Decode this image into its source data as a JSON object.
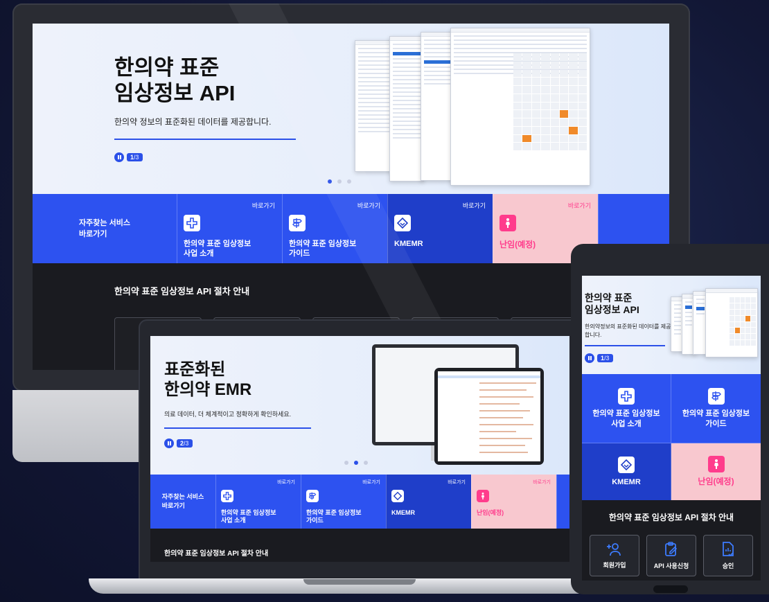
{
  "colors": {
    "accent": "#2d52f0",
    "accent_dark": "#1f3ec9",
    "pink_bg": "#f8c8cf",
    "pink_text": "#ff3c8c",
    "dark_band": "#1a1b20"
  },
  "monitor": {
    "hero": {
      "title_line1": "한의약 표준",
      "title_line2": "임상정보 API",
      "subtitle": "한의약 정보의 표준화된 데이터를 제공합니다.",
      "slide_current": "1",
      "slide_total": "/3"
    },
    "services": {
      "label_line1": "자주찾는 서비스",
      "label_line2": "바로가기",
      "go_label": "바로가기",
      "cards": [
        {
          "title_line1": "한의약 표준 임상정보",
          "title_line2": "사업 소개",
          "icon": "medical-cross-icon"
        },
        {
          "title_line1": "한의약 표준 임상정보",
          "title_line2": "가이드",
          "icon": "signpost-icon"
        },
        {
          "title_line1": "KMEMR",
          "title_line2": "",
          "icon": "kmemr-logo-icon"
        },
        {
          "title_line1": "난임(예정)",
          "title_line2": "",
          "icon": "pregnant-woman-icon"
        }
      ]
    },
    "procedure_title": "한의약 표준 임상정보 API 절차 안내"
  },
  "laptop": {
    "hero": {
      "title_line1": "표준화된",
      "title_line2": "한의약 EMR",
      "subtitle": "의료 데이터, 더 체계적이고 정확하게 확인하세요.",
      "slide_current": "2",
      "slide_total": "/3"
    },
    "services": {
      "label_line1": "자주찾는 서비스",
      "label_line2": "바로가기",
      "go_label": "바로가기",
      "cards": [
        {
          "title_line1": "한의약 표준 임상정보",
          "title_line2": "사업 소개"
        },
        {
          "title_line1": "한의약 표준 임상정보",
          "title_line2": "가이드"
        },
        {
          "title_line1": "KMEMR",
          "title_line2": ""
        },
        {
          "title_line1": "난임(예정)",
          "title_line2": ""
        }
      ]
    },
    "procedure_title": "한의약 표준 임상정보 API 절차 안내"
  },
  "tablet": {
    "hero": {
      "title_line1": "한의약 표준",
      "title_line2": "임상정보 API",
      "subtitle_line1": "한의약정보의 표준화된 데이터를 제공",
      "subtitle_line2": "합니다.",
      "slide_current": "1",
      "slide_total": "/3"
    },
    "cards": [
      {
        "title_line1": "한의약 표준 임상정보",
        "title_line2": "사업 소개"
      },
      {
        "title_line1": "한의약 표준 임상정보",
        "title_line2": "가이드"
      },
      {
        "title_line1": "KMEMR",
        "title_line2": ""
      },
      {
        "title_line1": "난임(예정)",
        "title_line2": ""
      }
    ],
    "procedure_title": "한의약 표준 임상정보 API 절차 안내",
    "steps": [
      {
        "label": "회원가입",
        "icon": "add-user-icon"
      },
      {
        "label": "API 사용신청",
        "icon": "clipboard-edit-icon"
      },
      {
        "label": "승인",
        "icon": "document-check-icon"
      }
    ]
  }
}
